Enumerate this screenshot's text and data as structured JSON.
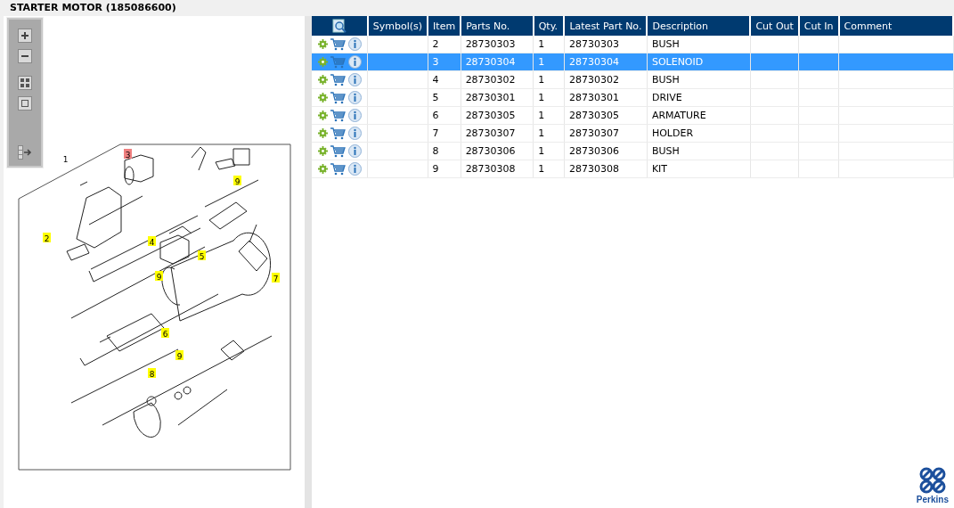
{
  "window": {
    "title": "STARTER MOTOR (185086600)"
  },
  "diagram": {
    "callouts": [
      {
        "label": "1",
        "selected": false
      },
      {
        "label": "3",
        "selected": true
      },
      {
        "label": "9",
        "selected": false
      },
      {
        "label": "2",
        "selected": false
      },
      {
        "label": "4",
        "selected": false
      },
      {
        "label": "5",
        "selected": false
      },
      {
        "label": "9",
        "selected": false
      },
      {
        "label": "7",
        "selected": false
      },
      {
        "label": "6",
        "selected": false
      },
      {
        "label": "9",
        "selected": false
      },
      {
        "label": "8",
        "selected": false
      }
    ]
  },
  "table": {
    "columns": [
      "Symbol(s)",
      "Item",
      "Parts No.",
      "Qty.",
      "Latest Part No.",
      "Description",
      "Cut Out",
      "Cut In",
      "Comment"
    ],
    "rows": [
      {
        "selected": false,
        "cells": [
          "",
          "2",
          "28730303",
          "1",
          "28730303",
          "BUSH",
          "",
          "",
          ""
        ]
      },
      {
        "selected": true,
        "cells": [
          "",
          "3",
          "28730304",
          "1",
          "28730304",
          "SOLENOID",
          "",
          "",
          ""
        ]
      },
      {
        "selected": false,
        "cells": [
          "",
          "4",
          "28730302",
          "1",
          "28730302",
          "BUSH",
          "",
          "",
          ""
        ]
      },
      {
        "selected": false,
        "cells": [
          "",
          "5",
          "28730301",
          "1",
          "28730301",
          "DRIVE",
          "",
          "",
          ""
        ]
      },
      {
        "selected": false,
        "cells": [
          "",
          "6",
          "28730305",
          "1",
          "28730305",
          "ARMATURE",
          "",
          "",
          ""
        ]
      },
      {
        "selected": false,
        "cells": [
          "",
          "7",
          "28730307",
          "1",
          "28730307",
          "HOLDER",
          "",
          "",
          ""
        ]
      },
      {
        "selected": false,
        "cells": [
          "",
          "8",
          "28730306",
          "1",
          "28730306",
          "BUSH",
          "",
          "",
          ""
        ]
      },
      {
        "selected": false,
        "cells": [
          "",
          "9",
          "28730308",
          "1",
          "28730308",
          "KIT",
          "",
          "",
          ""
        ]
      }
    ]
  },
  "logo": {
    "text": "Perkins"
  }
}
